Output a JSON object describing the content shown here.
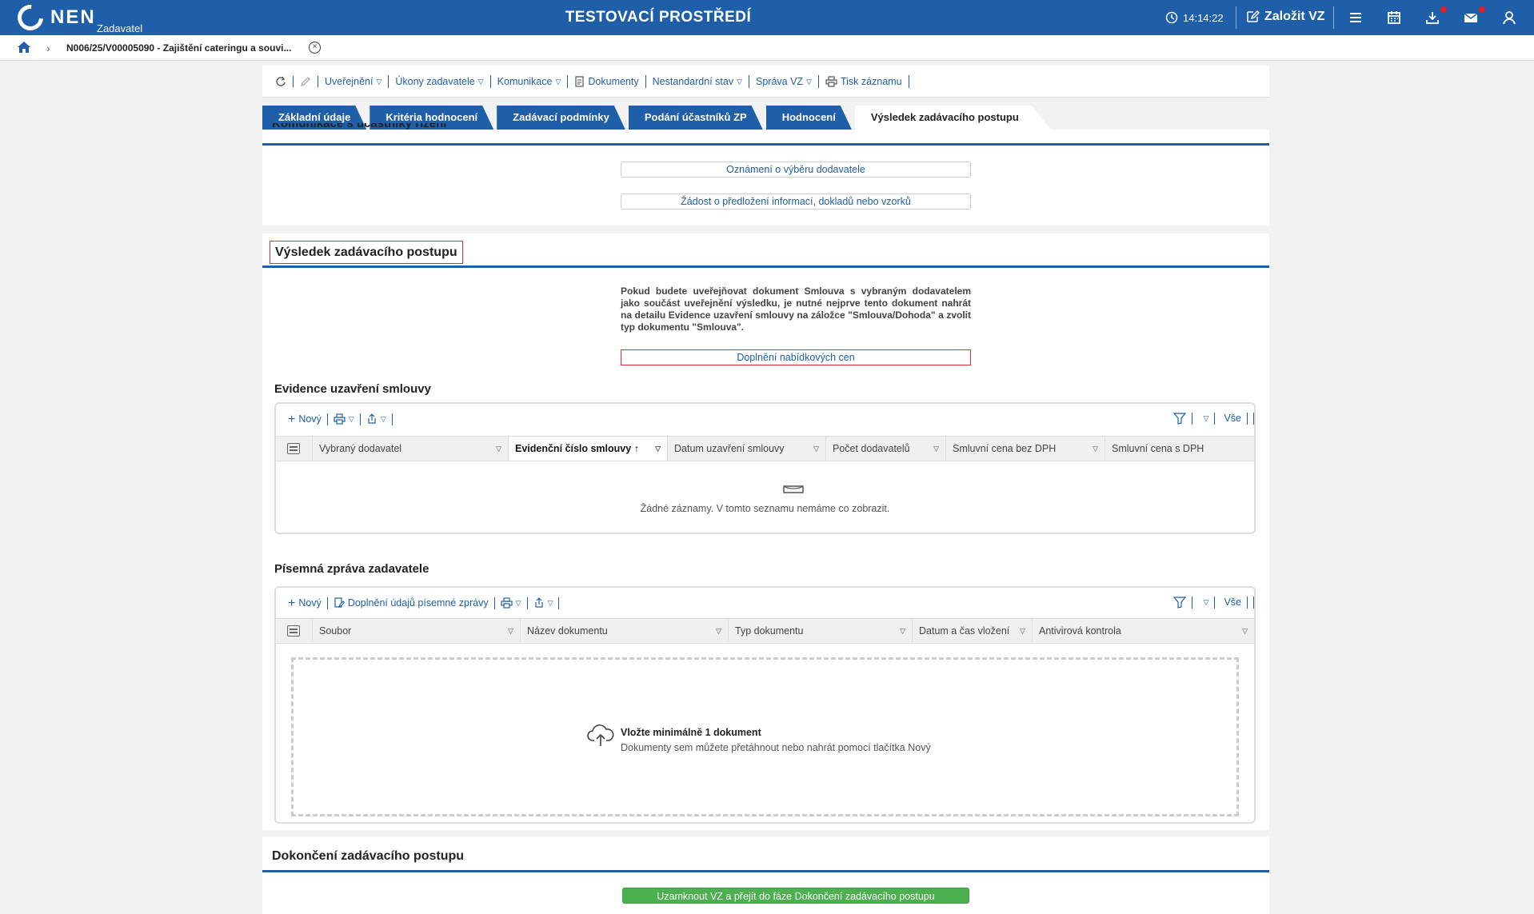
{
  "topbar": {
    "logo": "NEN",
    "logo_sub": "Zadavatel",
    "env_title": "TESTOVACÍ PROSTŘEDÍ",
    "clock": "14:14:22",
    "new_vz": "Založit VZ"
  },
  "breadcrumb": {
    "text": "N006/25/V00005090 - Zajištění cateringu a souvi..."
  },
  "actions": {
    "publish": "Uveřejnění",
    "acts": "Úkony zadavatele",
    "comm": "Komunikace",
    "docs": "Dokumenty",
    "nonstd": "Nestandardní stav",
    "admin": "Správa VZ",
    "print": "Tisk záznamu"
  },
  "tabs": [
    {
      "label": "Základní údaje"
    },
    {
      "label": "Kritéria hodnocení"
    },
    {
      "label": "Zadávací podmínky"
    },
    {
      "label": "Podání účastníků ZP"
    },
    {
      "label": "Hodnocení"
    },
    {
      "label": "Výsledek zadávacího postupu"
    }
  ],
  "comm_section": {
    "title": "Komunikace s účastníky řízení",
    "btn1": "Oznámení o výběru dodavatele",
    "btn2": "Žádost o předložení informací, dokladů nebo vzorků"
  },
  "result_section": {
    "title": "Výsledek zadávacího postupu",
    "info": "Pokud budete uveřejňovat dokument Smlouva s vybraným dodavatelem jako součást uveřejnění výsledku, je nutné nejprve tento dokument nahrát na detailu Evidence uzavření smlouvy na záložce \"Smlouva/Dohoda\" a zvolit typ dokumentu \"Smlouva\".",
    "btn_prices": "Doplnění nabídkových cen"
  },
  "contracts": {
    "title": "Evidence uzavření smlouvy",
    "new": "Nový",
    "all": "Vše",
    "columns": [
      "Vybraný dodavatel",
      "Evidenční číslo smlouvy",
      "Datum uzavření smlouvy",
      "Počet dodavatelů",
      "Smluvní cena bez DPH",
      "Smluvní cena s DPH"
    ],
    "empty": "Žádné záznamy. V tomto seznamu nemáme co zobrazit."
  },
  "report": {
    "title": "Písemná zpráva zadavatele",
    "new": "Nový",
    "fill": "Doplnění údajů písemné zprávy",
    "all": "Vše",
    "columns": [
      "Soubor",
      "Název dokumentu",
      "Typ dokumentu",
      "Datum a čas vložení",
      "Antivirová kontrola"
    ],
    "drop_title": "Vložte minimálně 1 dokument",
    "drop_sub": "Dokumenty sem můžete přetáhnout nebo nahrát pomocí tlačítka Nový"
  },
  "finish": {
    "title": "Dokončení zadávacího postupu",
    "btn": "Uzamknout VZ a přejít do fáze Dokončení zadávacího postupu"
  },
  "colors": {
    "brand": "#1f5ea8",
    "green": "#4caf50",
    "highlight": "#e03030"
  }
}
